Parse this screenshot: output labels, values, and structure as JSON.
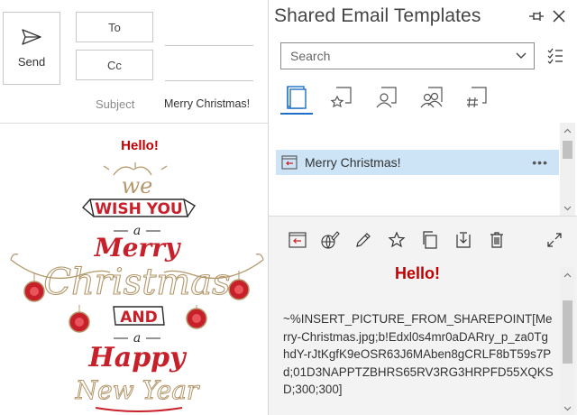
{
  "compose": {
    "send_label": "Send",
    "to_label": "To",
    "cc_label": "Cc",
    "subject_label": "Subject",
    "subject_value": "Merry Christmas!",
    "body_greeting": "Hello!",
    "art_lines": [
      "we",
      "WISH YOU",
      "a",
      "Merry",
      "Christmas",
      "AND",
      "a",
      "Happy",
      "New Year"
    ]
  },
  "pane": {
    "title": "Shared Email Templates",
    "search_placeholder": "Search",
    "tabs": [
      {
        "name": "all-templates",
        "icon": "folder-icon"
      },
      {
        "name": "favorites",
        "icon": "star-template-icon"
      },
      {
        "name": "my-templates",
        "icon": "personal-template-icon"
      },
      {
        "name": "team-templates",
        "icon": "team-template-icon"
      },
      {
        "name": "macros",
        "icon": "hash-template-icon"
      }
    ],
    "list_items": [
      {
        "label": "Merry Christmas!",
        "more": "•••"
      }
    ],
    "preview": {
      "greeting": "Hello!",
      "text": "~%INSERT_PICTURE_FROM_SHAREPOINT[Merry-Christmas.jpg;b!Edxl0s4mr0aDARry_p_za0TghdY-rJtKgfK9eOSR63J6MAben8gCRLF8bT59s7Pd;01D3NAPPTZBHRS65RV3RG3HRPFD55XQKSD;300;300]"
    }
  },
  "colors": {
    "accent": "#1e6fc5",
    "selection": "#cde4f7",
    "greeting_red": "#c00000",
    "art_red": "#c8202a",
    "art_gold": "#b3976a"
  }
}
